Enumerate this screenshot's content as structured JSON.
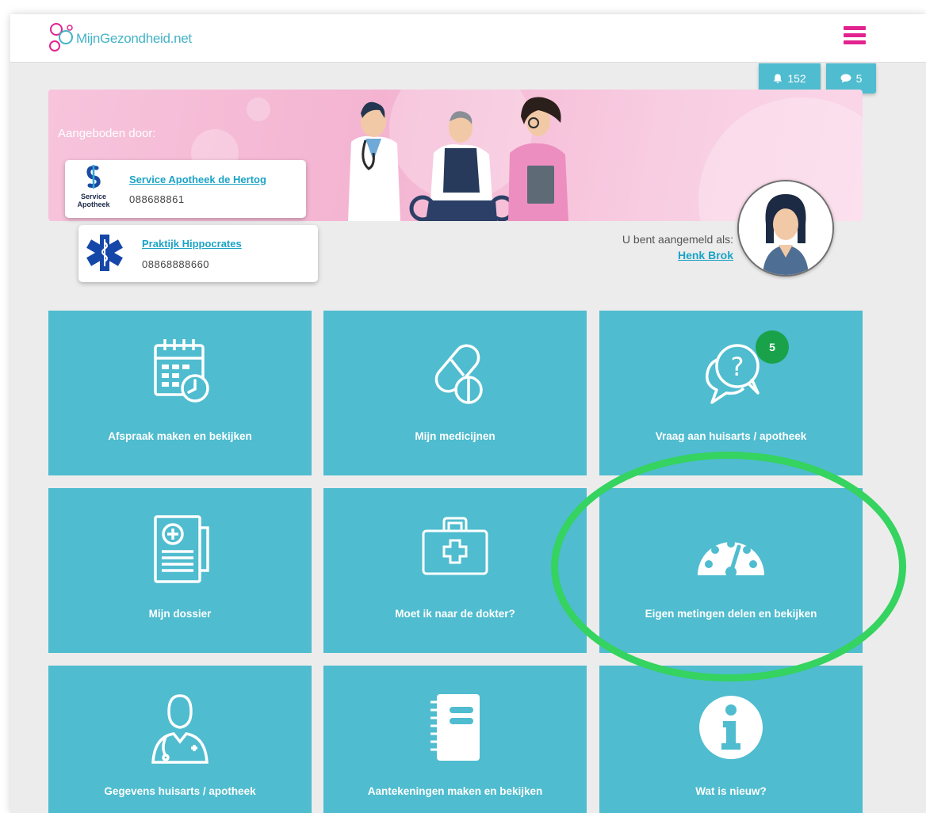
{
  "app": {
    "logo_text": "MijnGezondheid.net"
  },
  "notifications": {
    "bell_count": "152",
    "message_count": "5"
  },
  "banner": {
    "offered_by": "Aangeboden door:"
  },
  "providers": [
    {
      "name": "Service Apotheek de Hertog",
      "phone": "088688861",
      "logo_line1": "Service",
      "logo_line2": "Apotheek"
    },
    {
      "name": "Praktijk Hippocrates",
      "phone": "08868888660"
    }
  ],
  "user": {
    "logged_in_label": "U bent aangemeld als:",
    "name": "Henk Brok"
  },
  "tiles": [
    {
      "label": "Afspraak maken en bekijken",
      "icon": "calendar-clock-icon"
    },
    {
      "label": "Mijn medicijnen",
      "icon": "pills-icon"
    },
    {
      "label": "Vraag aan huisarts / apotheek",
      "icon": "chat-question-icon",
      "badge": "5"
    },
    {
      "label": "Mijn dossier",
      "icon": "medical-file-icon"
    },
    {
      "label": "Moet ik naar de dokter?",
      "icon": "medical-kit-icon"
    },
    {
      "label": "Eigen metingen delen en bekijken",
      "icon": "gauge-icon"
    },
    {
      "label": "Gegevens huisarts / apotheek",
      "icon": "doctor-icon"
    },
    {
      "label": "Aantekeningen maken en bekijken",
      "icon": "notebook-icon"
    },
    {
      "label": "Wat is nieuw?",
      "icon": "info-icon"
    }
  ],
  "colors": {
    "tile": "#4fbccf",
    "accent": "#e2238f",
    "link": "#1ba3c6",
    "badge": "#1aa24a",
    "highlight": "#35d35f"
  }
}
